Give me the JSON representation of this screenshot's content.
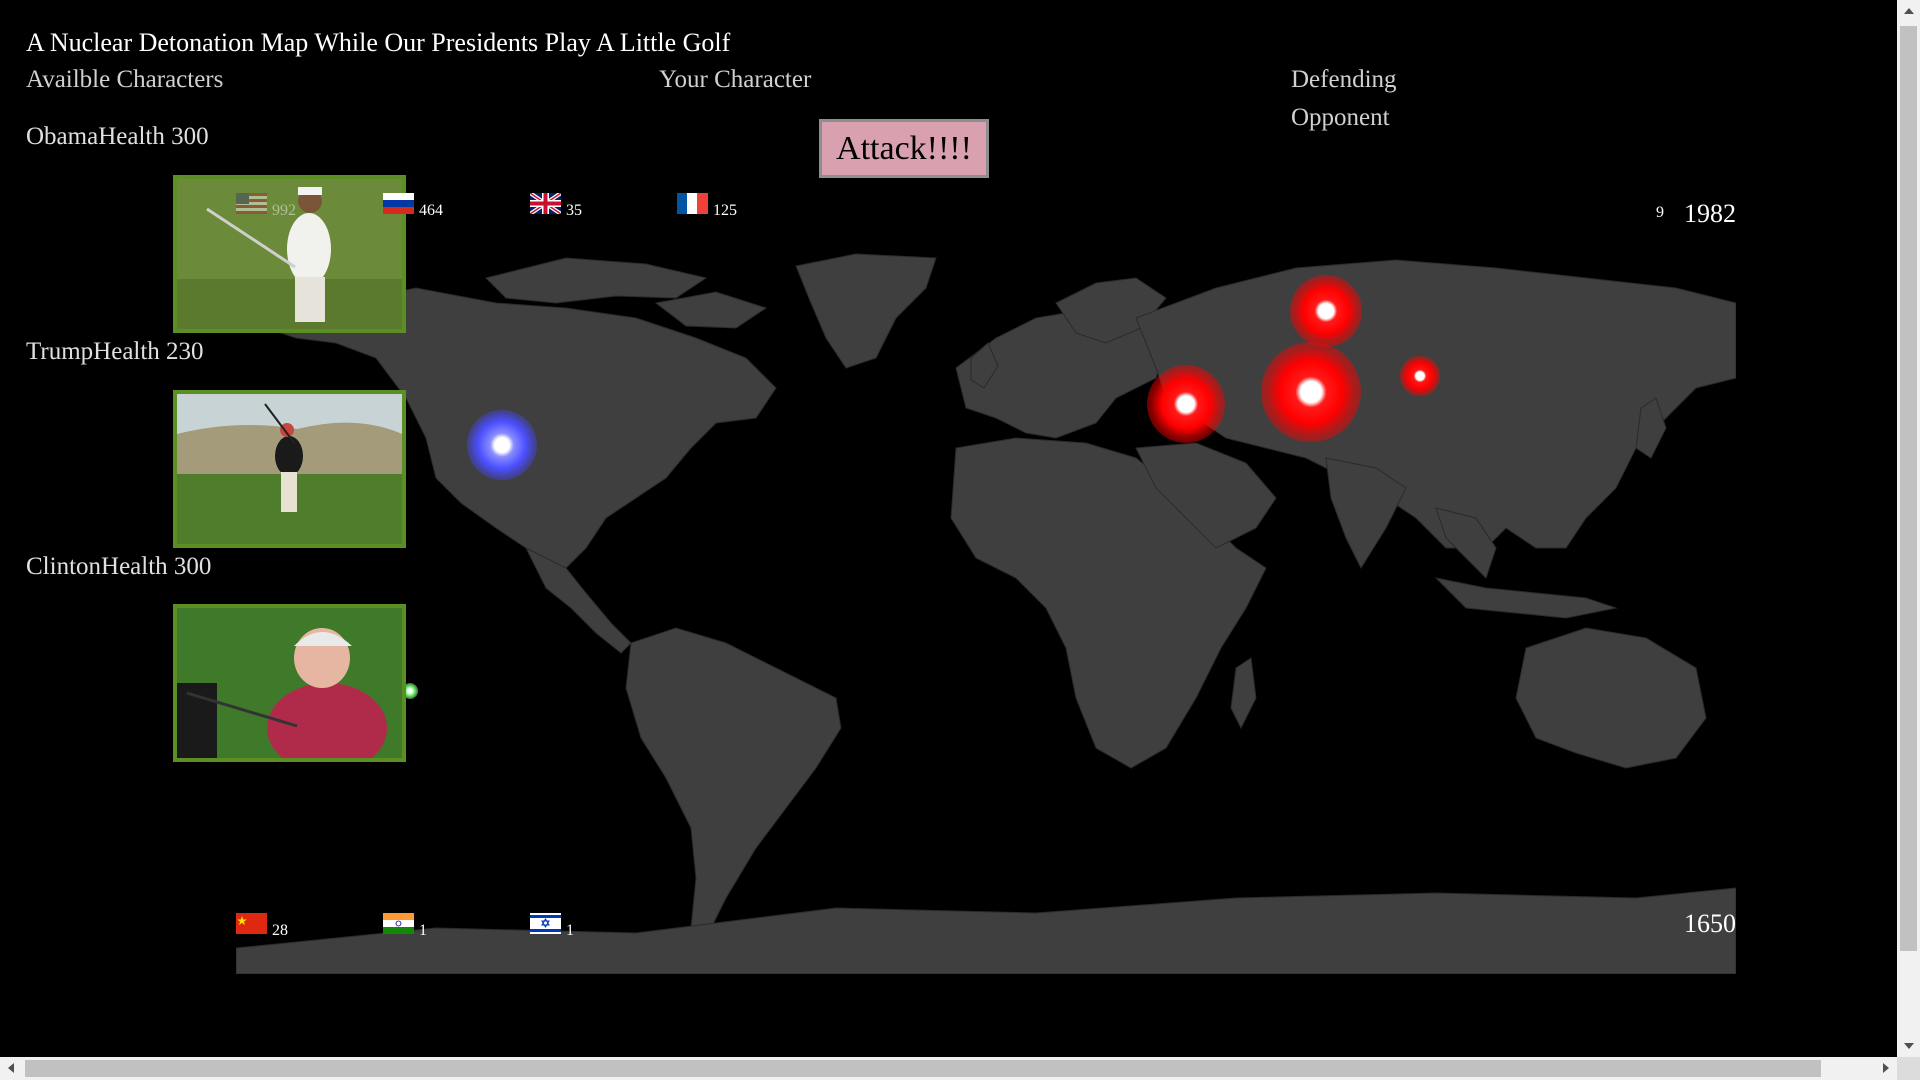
{
  "page": {
    "title": "A Nuclear Detonation Map While Our Presidents Play A Little Golf"
  },
  "columns": {
    "available": "Availble Characters",
    "your": "Your Character",
    "defending_line1": "Defending",
    "defending_line2": "Opponent"
  },
  "attack_button": {
    "label": "Attack!!!!"
  },
  "characters": [
    {
      "name": "Obama",
      "health_label": "Health 300",
      "label": "ObamaHealth 300"
    },
    {
      "name": "Trump",
      "health_label": "Health 230",
      "label": "TrumpHealth 230"
    },
    {
      "name": "Clinton",
      "health_label": "Health 300",
      "label": "ClintonHealth 300"
    }
  ],
  "arsenal_top": [
    {
      "country": "USA",
      "icon": "us-flag-icon",
      "count": "992"
    },
    {
      "country": "Russia",
      "icon": "russia-flag-icon",
      "count": "464"
    },
    {
      "country": "UK",
      "icon": "uk-flag-icon",
      "count": "35"
    },
    {
      "country": "France",
      "icon": "france-flag-icon",
      "count": "125"
    }
  ],
  "arsenal_bottom": [
    {
      "country": "China",
      "icon": "china-flag-icon",
      "count": "28"
    },
    {
      "country": "India",
      "icon": "india-flag-icon",
      "count": "1"
    },
    {
      "country": "Israel",
      "icon": "israel-flag-icon",
      "count": "1"
    }
  ],
  "stats": {
    "small_counter": "9",
    "year_current": "1982",
    "year_start": "1650"
  },
  "colors": {
    "background": "#000000",
    "land": "#3f3f3f",
    "portrait_border": "#5b8f24",
    "attack_button_bg": "#d9a1b0",
    "blast_red": "#ff0000",
    "blast_blue": "#4b4fff"
  }
}
